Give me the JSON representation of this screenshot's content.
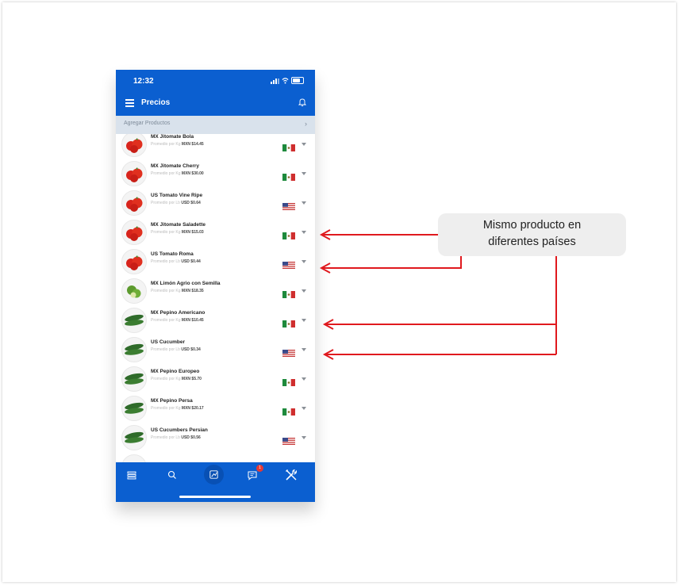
{
  "status_bar": {
    "time": "12:32"
  },
  "header": {
    "title": "Precios"
  },
  "agregar": {
    "label": "Agregar Productos",
    "chevron": "›"
  },
  "products": [
    {
      "name": "MX Jitomate Bola",
      "avg_label": "Promedio por Kg",
      "price": "MXN $14.45",
      "flag": "mx-flag-icon",
      "img": "tomato"
    },
    {
      "name": "MX Jitomate Cherry",
      "avg_label": "Promedio por Kg",
      "price": "MXN $30.00",
      "flag": "mx-flag-icon",
      "img": "tomato"
    },
    {
      "name": "US Tomato Vine Ripe",
      "avg_label": "Promedio por Lb",
      "price": "USD $0.64",
      "flag": "us-flag-icon",
      "img": "tomato"
    },
    {
      "name": "MX Jitomate Saladette",
      "avg_label": "Promedio por Kg",
      "price": "MXN $15.03",
      "flag": "mx-flag-icon",
      "img": "tomato"
    },
    {
      "name": "US Tomato Roma",
      "avg_label": "Promedio por Lb",
      "price": "USD $0.44",
      "flag": "us-flag-icon",
      "img": "tomato"
    },
    {
      "name": "MX Limón Agrio con Semilla",
      "avg_label": "Promedio por Kg",
      "price": "MXN $18.35",
      "flag": "mx-flag-icon",
      "img": "lime"
    },
    {
      "name": "MX Pepino Americano",
      "avg_label": "Promedio por Kg",
      "price": "MXN $10.45",
      "flag": "mx-flag-icon",
      "img": "cucumber"
    },
    {
      "name": "US Cucumber",
      "avg_label": "Promedio por Lb",
      "price": "USD $0.34",
      "flag": "us-flag-icon",
      "img": "cucumber"
    },
    {
      "name": "MX Pepino Europeo",
      "avg_label": "Promedio por Kg",
      "price": "MXN $5.70",
      "flag": "mx-flag-icon",
      "img": "cucumber"
    },
    {
      "name": "MX Pepino Persa",
      "avg_label": "Promedio por Kg",
      "price": "MXN $20.17",
      "flag": "mx-flag-icon",
      "img": "cucumber"
    },
    {
      "name": "US Cucumbers Persian",
      "avg_label": "Promedio por Lb",
      "price": "USD $0.56",
      "flag": "us-flag-icon",
      "img": "cucumber"
    }
  ],
  "bottom_nav": {
    "items": [
      "list-icon",
      "search-icon",
      "chart-icon",
      "chat-icon",
      "tools-icon"
    ],
    "badge": "1"
  },
  "callout": {
    "line1": "Mismo producto en",
    "line2": "diferentes países"
  },
  "colors": {
    "brand": "#0b5fd0",
    "arrow": "#e0191e",
    "badge": "#e53935"
  }
}
